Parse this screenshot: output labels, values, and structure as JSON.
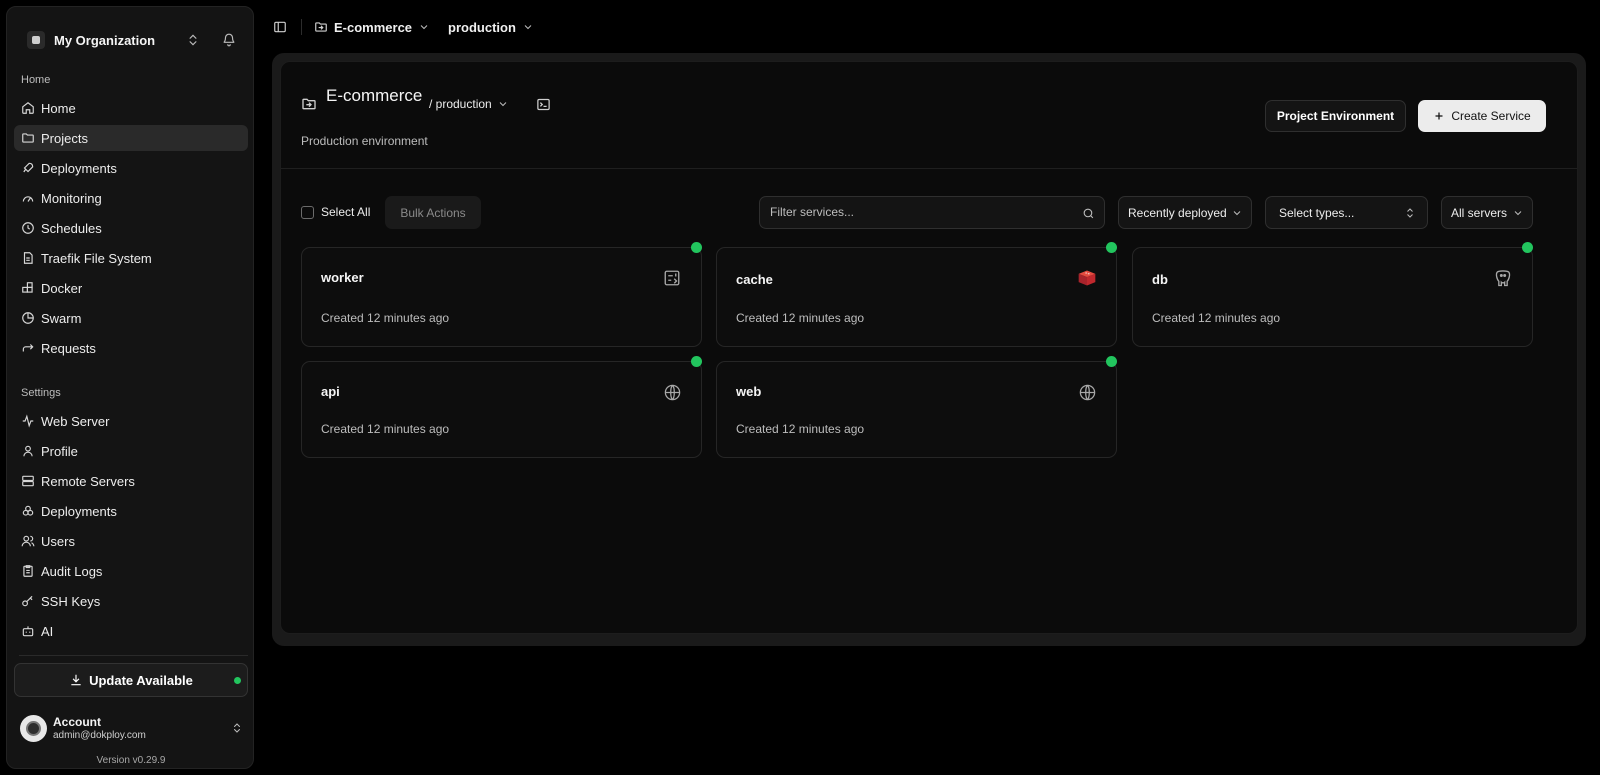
{
  "sidebar": {
    "org_name": "My Organization",
    "home_section": "Home",
    "home_items": [
      {
        "label": "Home",
        "icon": "house-icon",
        "active": false
      },
      {
        "label": "Projects",
        "icon": "folder-icon",
        "active": true
      },
      {
        "label": "Deployments",
        "icon": "rocket-icon",
        "active": false
      },
      {
        "label": "Monitoring",
        "icon": "gauge-icon",
        "active": false
      },
      {
        "label": "Schedules",
        "icon": "clock-icon",
        "active": false
      },
      {
        "label": "Traefik File System",
        "icon": "file-icon",
        "active": false
      },
      {
        "label": "Docker",
        "icon": "blocks-icon",
        "active": false
      },
      {
        "label": "Swarm",
        "icon": "pie-icon",
        "active": false
      },
      {
        "label": "Requests",
        "icon": "arrow-forward-icon",
        "active": false
      }
    ],
    "settings_section": "Settings",
    "settings_items": [
      {
        "label": "Web Server",
        "icon": "activity-icon"
      },
      {
        "label": "Profile",
        "icon": "user-icon"
      },
      {
        "label": "Remote Servers",
        "icon": "server-icon"
      },
      {
        "label": "Deployments",
        "icon": "boxes-icon"
      },
      {
        "label": "Users",
        "icon": "users-icon"
      },
      {
        "label": "Audit Logs",
        "icon": "clipboard-icon"
      },
      {
        "label": "SSH Keys",
        "icon": "key-icon"
      },
      {
        "label": "AI",
        "icon": "bot-icon"
      }
    ],
    "update_label": "Update Available",
    "account": {
      "name": "Account",
      "email": "admin@dokploy.com"
    },
    "version": "Version v0.29.9"
  },
  "topbar": {
    "project": "E-commerce",
    "environment": "production"
  },
  "header": {
    "title": "E-commerce",
    "env_crumb": "/ production",
    "description": "Production environment",
    "env_button": "Project Environment",
    "create_button": "Create Service"
  },
  "toolbar": {
    "select_all": "Select All",
    "bulk_actions": "Bulk Actions",
    "filter_placeholder": "Filter services...",
    "sort": "Recently deployed",
    "types": "Select types...",
    "servers": "All servers"
  },
  "services": [
    {
      "name": "worker",
      "created": "Created 12 minutes ago",
      "icon": "compose-icon"
    },
    {
      "name": "cache",
      "created": "Created 12 minutes ago",
      "icon": "redis-icon"
    },
    {
      "name": "db",
      "created": "Created 12 minutes ago",
      "icon": "postgres-icon"
    },
    {
      "name": "api",
      "created": "Created 12 minutes ago",
      "icon": "globe-icon"
    },
    {
      "name": "web",
      "created": "Created 12 minutes ago",
      "icon": "globe-icon"
    }
  ],
  "colors": {
    "status_running": "#22c55e",
    "redis": "#c0282d"
  }
}
